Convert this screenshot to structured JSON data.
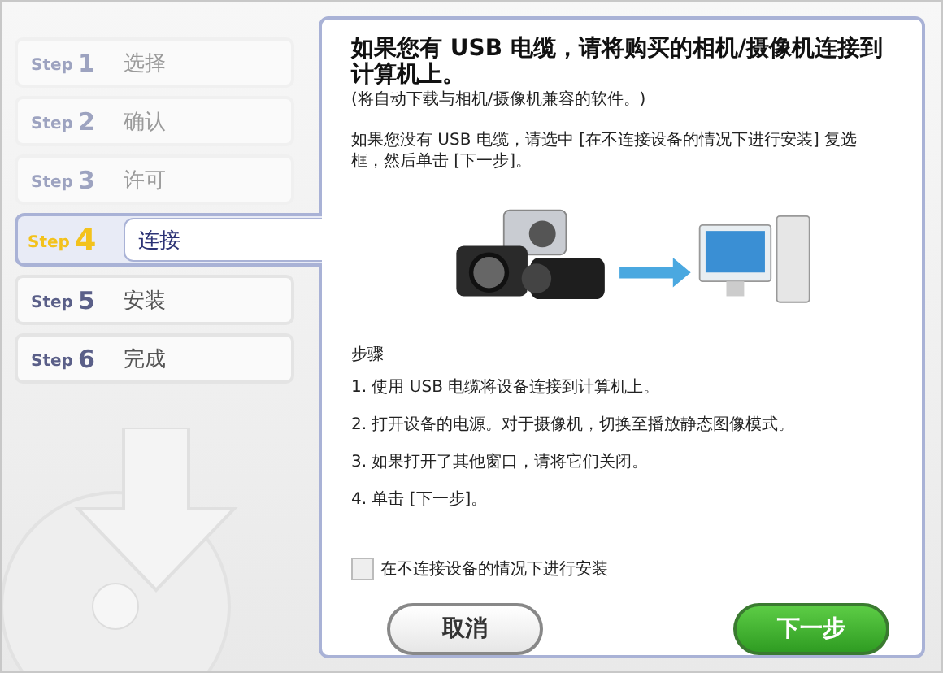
{
  "steps": [
    {
      "prefix": "Step",
      "number": "1",
      "label": "选择",
      "selected": false,
      "completed": true
    },
    {
      "prefix": "Step",
      "number": "2",
      "label": "确认",
      "selected": false,
      "completed": true
    },
    {
      "prefix": "Step",
      "number": "3",
      "label": "许可",
      "selected": false,
      "completed": true
    },
    {
      "prefix": "Step",
      "number": "4",
      "label": "连接",
      "selected": true,
      "completed": false
    },
    {
      "prefix": "Step",
      "number": "5",
      "label": "安装",
      "selected": false,
      "completed": false
    },
    {
      "prefix": "Step",
      "number": "6",
      "label": "完成",
      "selected": false,
      "completed": false
    }
  ],
  "panel": {
    "title": "如果您有 USB 电缆，请将购买的相机/摄像机连接到计算机上。",
    "subtitle": "(将自动下载与相机/摄像机兼容的软件。)",
    "note": "如果您没有 USB 电缆，请选中 [在不连接设备的情况下进行安装] 复选框，然后单击 [下一步]。",
    "steps_heading": "步骤",
    "instructions": [
      "1. 使用 USB 电缆将设备连接到计算机上。",
      "2. 打开设备的电源。对于摄像机，切换至播放静态图像模式。",
      "3. 如果打开了其他窗口，请将它们关闭。",
      "4. 单击 [下一步]。"
    ],
    "checkbox": {
      "label": "在不连接设备的情况下进行安装",
      "checked": false
    }
  },
  "buttons": [
    {
      "label": "取消",
      "kind": "secondary"
    },
    {
      "label": "下一步",
      "kind": "primary"
    }
  ]
}
